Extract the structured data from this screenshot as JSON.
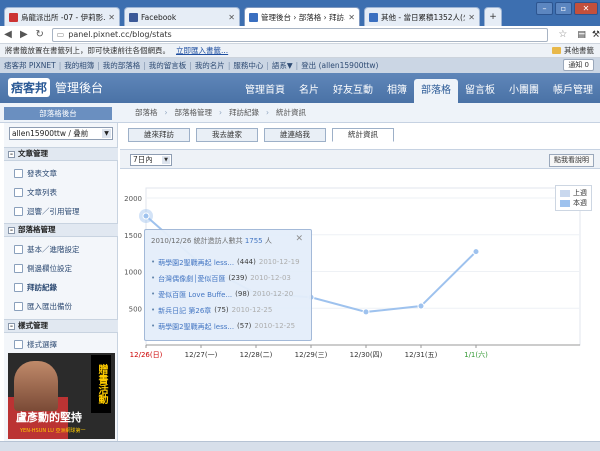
{
  "browser": {
    "tabs": [
      {
        "title": "烏龍派出所 -07 - 伊莉影...",
        "favicon_color": "#cc3333"
      },
      {
        "title": "Facebook",
        "favicon_color": "#3b5998"
      },
      {
        "title": "管理後台 › 部落格 › 拜訪...",
        "favicon_color": "#3a6fc0"
      },
      {
        "title": "其他 - 當日累積1352人(少...",
        "favicon_color": "#3a6fc0"
      }
    ],
    "url": "panel.pixnet.cc/blog/stats",
    "bookmark_notice": "將書籤放置在書籤列上，即可快速前往各個網頁。",
    "bookmark_link": "立即匯入書籤...",
    "other_bookmarks": "其他書籤"
  },
  "sitebar": {
    "links": [
      "痞客邦 PIXNET",
      "我的相簿",
      "我的部落格",
      "我的留言板",
      "我的名片",
      "服務中心",
      "語系▼",
      "登出 (allen15900ttw)"
    ],
    "notice": "通知 0"
  },
  "header": {
    "logo_mark": "痞客邦",
    "logo_text": "管理後台",
    "nav": [
      "管理首頁",
      "名片",
      "好友互動",
      "相簿",
      "部落格",
      "留言板",
      "小團團",
      "帳戶管理"
    ]
  },
  "subnav": {
    "sidebar_heading": "部落格後台",
    "breadcrumb": [
      "部落格",
      "部落格管理",
      "拜訪紀錄",
      "統計資訊"
    ]
  },
  "sidebar": {
    "blog_select": "allen15900ttw / 叠前",
    "sections": [
      {
        "title": "文章管理",
        "items": [
          "發表文章",
          "文章列表",
          "迴響／引用管理"
        ]
      },
      {
        "title": "部落格管理",
        "items": [
          "基本／進階設定",
          "側邊欄位設定",
          "拜訪紀錄",
          "匯入匯出備份"
        ]
      },
      {
        "title": "樣式管理",
        "items": [
          "樣式選擇"
        ]
      }
    ],
    "ad": {
      "vertical_text": "贈書活動",
      "big_text": "盧彥勳的堅持",
      "sub_text": "YEN-HSUN LU 亞洲網球第一"
    }
  },
  "content": {
    "tabs": [
      "誰來拜訪",
      "我去誰家",
      "誰連絡我",
      "統計資訊"
    ],
    "active_tab": 3,
    "range": "7日內",
    "help_button": "點我看說明"
  },
  "chart_data": {
    "type": "line",
    "categories": [
      "12/26(日)",
      "12/27(一)",
      "12/28(二)",
      "12/29(三)",
      "12/30(四)",
      "12/31(五)",
      "1/1(六)"
    ],
    "ylim": [
      0,
      2000
    ],
    "yticks": [
      "2000",
      "1500",
      "1000",
      "500"
    ],
    "series": [
      {
        "name": "上週",
        "color": "#c9d8ee",
        "values": [
          null,
          null,
          null,
          null,
          null,
          null,
          null
        ]
      },
      {
        "name": "本週",
        "color": "#9ec2ee",
        "values": [
          1755,
          1100,
          700,
          650,
          450,
          530,
          1270
        ]
      }
    ],
    "highlight_category": 0,
    "highlight_color": "#cc0000",
    "last_category_color": "#339933"
  },
  "tooltip": {
    "header_prefix": "2010/12/26 統計造訪人數共",
    "count": "1755",
    "suffix": "人",
    "items": [
      {
        "title": "萌學園2聖戰再起 less...",
        "count": "(444)",
        "date": "2010-12-19"
      },
      {
        "title": "台灣偶像劇│愛似百匯",
        "count": "(239)",
        "date": "2010-12-03"
      },
      {
        "title": "愛似百匯 Love Buffe...",
        "count": "(98)",
        "date": "2010-12-20"
      },
      {
        "title": "新兵日記 第26章",
        "count": "(75)",
        "date": "2010-12-25"
      },
      {
        "title": "萌學園2聖戰再起 less...",
        "count": "(57)",
        "date": "2010-12-25"
      }
    ]
  }
}
